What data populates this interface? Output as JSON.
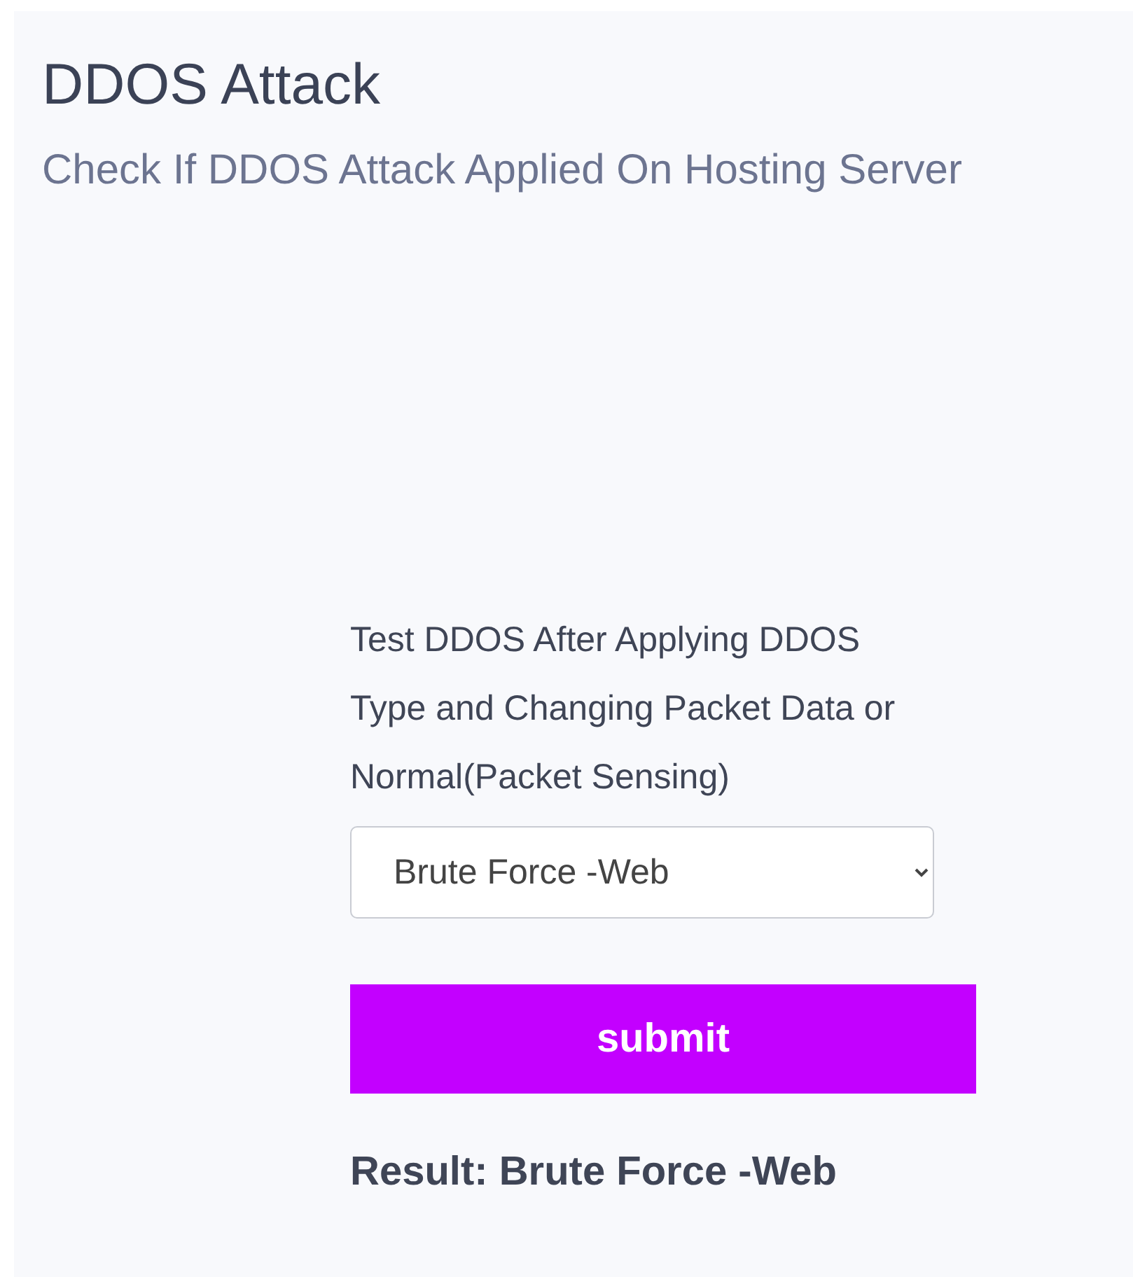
{
  "header": {
    "title": "DDOS Attack",
    "subtitle": "Check If DDOS Attack Applied On Hosting Server"
  },
  "form": {
    "label": "Test DDOS After Applying DDOS Type and Changing Packet Data or Normal(Packet Sensing)",
    "select": {
      "value": "Brute Force -Web"
    },
    "button": "submit",
    "result": "Result: Brute Force -Web"
  }
}
